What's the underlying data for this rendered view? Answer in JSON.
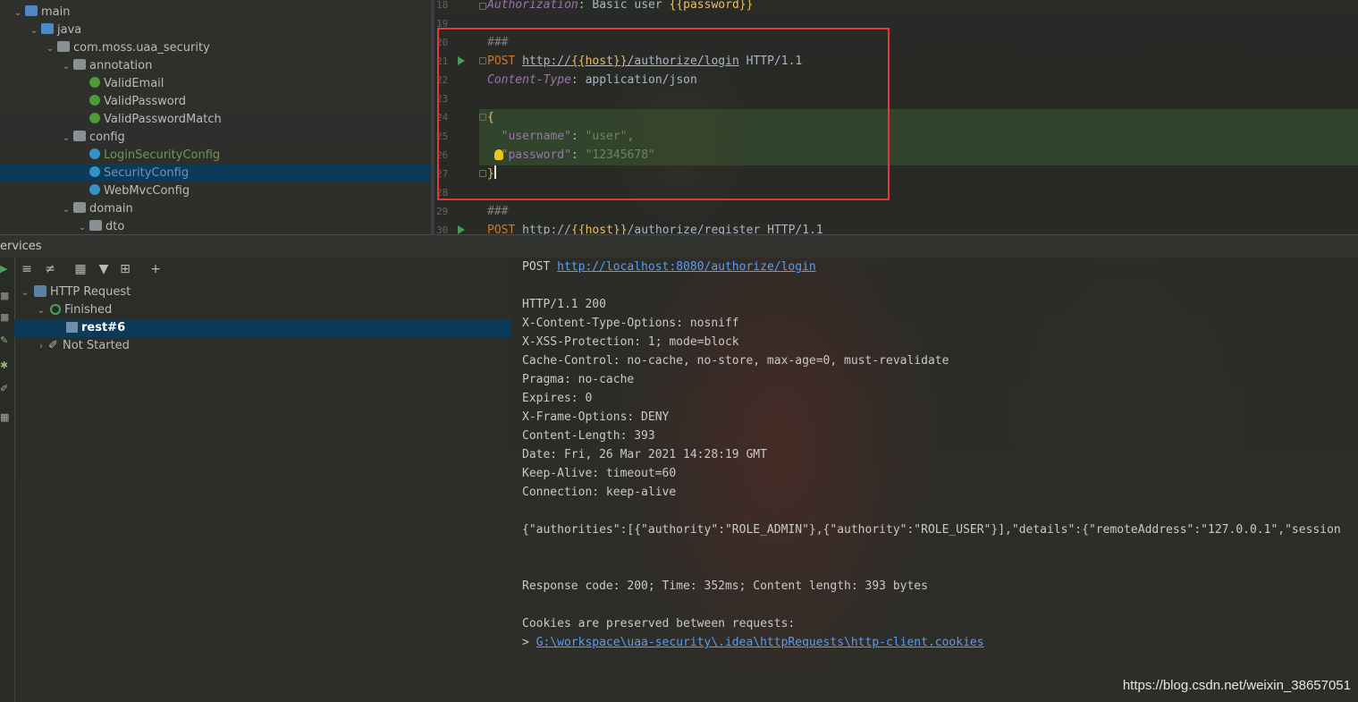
{
  "project_tree": [
    {
      "label": "main",
      "indent": 1,
      "icon": "folder-blue",
      "expanded": true
    },
    {
      "label": "java",
      "indent": 2,
      "icon": "folder-blue",
      "expanded": true
    },
    {
      "label": "com.moss.uaa_security",
      "indent": 3,
      "icon": "folder-pkg",
      "expanded": true
    },
    {
      "label": "annotation",
      "indent": 4,
      "icon": "folder-pkg",
      "expanded": true
    },
    {
      "label": "ValidEmail",
      "indent": 5,
      "icon": "anno"
    },
    {
      "label": "ValidPassword",
      "indent": 5,
      "icon": "anno"
    },
    {
      "label": "ValidPasswordMatch",
      "indent": 5,
      "icon": "anno"
    },
    {
      "label": "config",
      "indent": 4,
      "icon": "folder-pkg",
      "expanded": true
    },
    {
      "label": "LoginSecurityConfig",
      "indent": 5,
      "icon": "cls",
      "color": "green"
    },
    {
      "label": "SecurityConfig",
      "indent": 5,
      "icon": "cls",
      "color": "blue",
      "selected": true
    },
    {
      "label": "WebMvcConfig",
      "indent": 5,
      "icon": "cls"
    },
    {
      "label": "domain",
      "indent": 4,
      "icon": "folder-pkg",
      "expanded": true
    },
    {
      "label": "dto",
      "indent": 5,
      "icon": "folder-pkg",
      "expanded": true
    }
  ],
  "editor": {
    "line_numbers": [
      "18",
      "19",
      "20",
      "21",
      "22",
      "23",
      "24",
      "25",
      "26",
      "27",
      "28",
      "29",
      "30"
    ],
    "lines": {
      "l18_key": "Authorization",
      "l18_val": ": Basic user ",
      "l18_var": "{{password}}",
      "l20": "###",
      "l21_method": "POST ",
      "l21_url_a": "http://",
      "l21_url_var": "{{host}}",
      "l21_url_b": "/authorize/login",
      "l21_proto": " HTTP/1.1",
      "l22_key": "Content-Type",
      "l22_val": ": application/json",
      "l24": "{",
      "l25_key": "  \"username\"",
      "l25_sep": ": ",
      "l25_val": "\"user\"",
      "l25_end": ",",
      "l26_key": "  \"password\"",
      "l26_sep": ": ",
      "l26_val": "\"12345678\"",
      "l27": "}",
      "l29": "###",
      "l30_method": "POST ",
      "l30_url_a": "http://",
      "l30_url_var": "{{host}}",
      "l30_url_b": "/authorize/register",
      "l30_proto": " HTTP/1.1"
    }
  },
  "services": {
    "title": "ervices",
    "tree": [
      {
        "label": "HTTP Request",
        "icon": "api-icon",
        "expanded": true
      },
      {
        "label": "Finished",
        "icon": "finished-icon",
        "expanded": true
      },
      {
        "label": "rest#6",
        "icon": "rest-icon",
        "selected": true
      },
      {
        "label": "Not Started",
        "icon": "wrench-icon",
        "expanded": false
      }
    ]
  },
  "response": {
    "request_method": "POST ",
    "request_url": "http://localhost:8080/authorize/login",
    "status_line": "HTTP/1.1 200",
    "headers": [
      "X-Content-Type-Options: nosniff",
      "X-XSS-Protection: 1; mode=block",
      "Cache-Control: no-cache, no-store, max-age=0, must-revalidate",
      "Pragma: no-cache",
      "Expires: 0",
      "X-Frame-Options: DENY",
      "Content-Length: 393",
      "Date: Fri, 26 Mar 2021 14:28:19 GMT",
      "Keep-Alive: timeout=60",
      "Connection: keep-alive"
    ],
    "body": "{\"authorities\":[{\"authority\":\"ROLE_ADMIN\"},{\"authority\":\"ROLE_USER\"}],\"details\":{\"remoteAddress\":\"127.0.0.1\",\"session",
    "summary": "Response code: 200; Time: 352ms; Content length: 393 bytes",
    "cookies_note": "Cookies are preserved between requests:",
    "cookies_prefix": "> ",
    "cookies_path": "G:\\workspace\\uaa-security\\.idea\\httpRequests\\http-client.cookies"
  },
  "watermark": "https://blog.csdn.net/weixin_38657051"
}
